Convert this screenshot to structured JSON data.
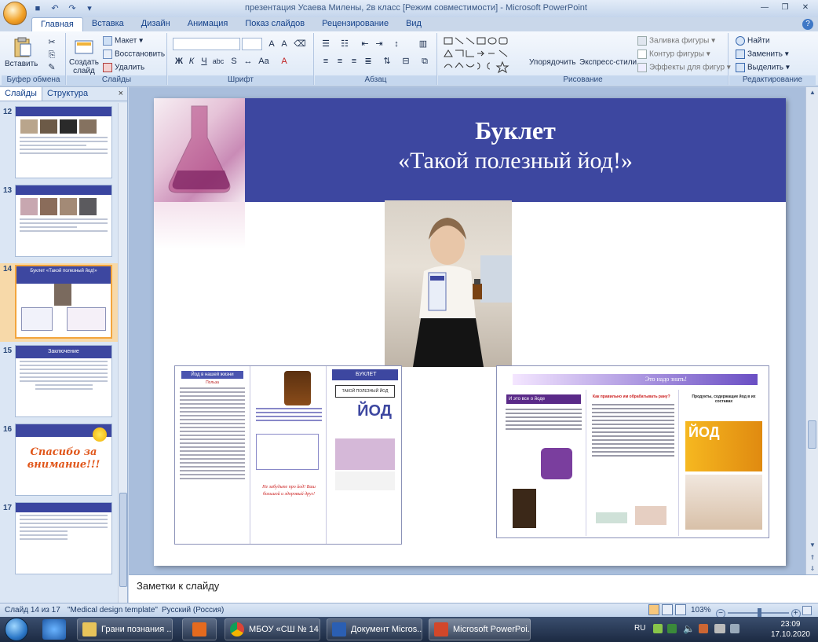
{
  "window": {
    "title": "презентация Усаева Милены, 2в класс [Режим совместимости] - Microsoft PowerPoint"
  },
  "ribbon_tabs": [
    "Главная",
    "Вставка",
    "Дизайн",
    "Анимация",
    "Показ слайдов",
    "Рецензирование",
    "Вид"
  ],
  "ribbon": {
    "clipboard": {
      "paste": "Вставить",
      "group": "Буфер обмена"
    },
    "slides": {
      "new_slide": "Создать слайд",
      "layout": "Макет",
      "reset": "Восстановить",
      "delete": "Удалить",
      "group": "Слайды"
    },
    "font": {
      "group": "Шрифт",
      "font_name": "",
      "font_size": ""
    },
    "paragraph": {
      "group": "Абзац"
    },
    "drawing": {
      "arrange": "Упорядочить",
      "quick_styles": "Экспресс-стили",
      "fill": "Заливка фигуры",
      "outline": "Контур фигуры",
      "effects": "Эффекты для фигур",
      "group": "Рисование"
    },
    "editing": {
      "find": "Найти",
      "replace": "Заменить",
      "select": "Выделить",
      "group": "Редактирование"
    }
  },
  "left_pane": {
    "tabs": [
      "Слайды",
      "Структура"
    ],
    "close": "×",
    "thumbnails": [
      {
        "number": "12",
        "title": ""
      },
      {
        "number": "13",
        "title": ""
      },
      {
        "number": "14",
        "title": "Буклет «Такой полезный йод!»"
      },
      {
        "number": "15",
        "title": "Заключение"
      },
      {
        "number": "16",
        "title": "Спасибо за внимание!!!"
      },
      {
        "number": "17",
        "title": ""
      }
    ]
  },
  "slide": {
    "title": "Буклет",
    "subtitle": "«Такой полезный йод!»",
    "booklet_left": {
      "col1_head": "Йод в нашей жизни",
      "col1_sub": "Польза",
      "col3_head": "БУКЛЕТ",
      "col3_title": "ТАКОЙ ПОЛЕЗНЫЙ ЙОД",
      "col3_big": "ЙОД",
      "col2_note": "Не забудьте про йод! Ваш большой и здоровый друг!"
    },
    "booklet_right": {
      "banner": "Это надо знать!",
      "col1_title": "И это все о йоде",
      "col2_title": "Как правильно им обрабатывать рану?",
      "col3_title": "Продукты, содержащие йод в их составах",
      "col3_big": "ЙОД"
    }
  },
  "notes": {
    "placeholder": "Заметки к слайду"
  },
  "status_bar": {
    "slide_info": "Слайд 14 из 17",
    "theme": "\"Medical design template\"",
    "language": "Русский (Россия)",
    "zoom": "103%"
  },
  "taskbar": {
    "items": [
      "Грани познания ...",
      "",
      "МБОУ «СШ № 14...",
      "Документ Micros...",
      "Microsoft PowerPoi..."
    ],
    "lang": "RU",
    "time": "23:09",
    "date": "17.10.2020"
  }
}
